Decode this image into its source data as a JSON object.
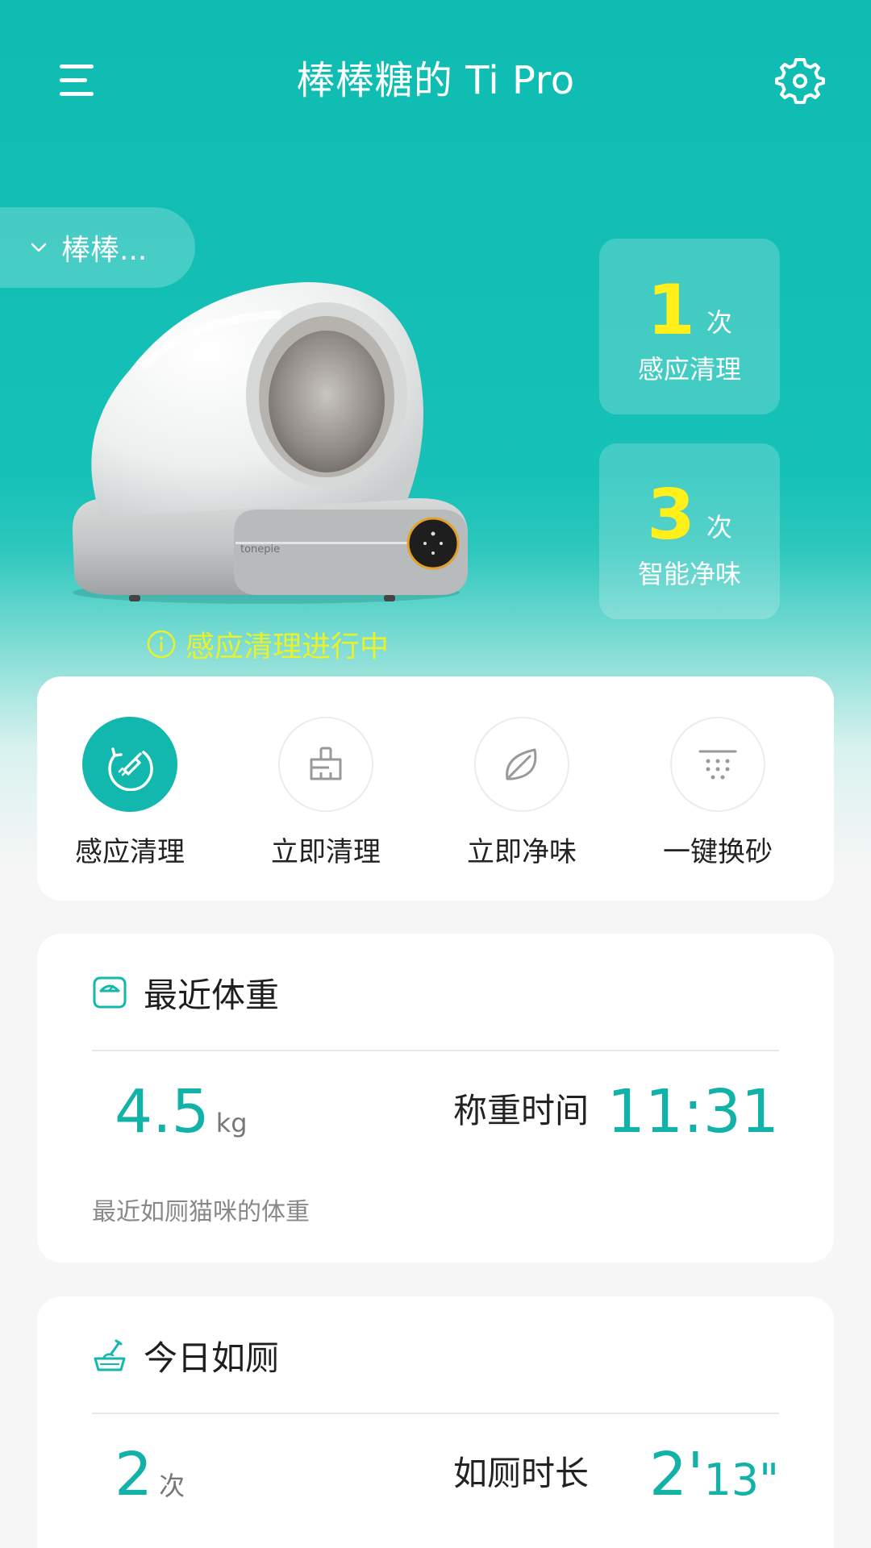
{
  "header": {
    "title": "棒棒糖的 Ti Pro",
    "menu_icon": "menu-icon",
    "settings_icon": "gear-icon"
  },
  "cat_selector": {
    "label": "棒棒..."
  },
  "device": {
    "brand_text": "tonepie"
  },
  "stats": [
    {
      "value": "1",
      "unit": "次",
      "label": "感应清理"
    },
    {
      "value": "3",
      "unit": "次",
      "label": "智能净味"
    }
  ],
  "status": {
    "text": "感应清理进行中",
    "color": "#e8f22a"
  },
  "actions": [
    {
      "label": "感应清理",
      "icon": "auto-clean-icon",
      "active": true
    },
    {
      "label": "立即清理",
      "icon": "broom-icon",
      "active": false
    },
    {
      "label": "立即净味",
      "icon": "leaf-icon",
      "active": false
    },
    {
      "label": "一键换砂",
      "icon": "litter-change-icon",
      "active": false
    }
  ],
  "weight_card": {
    "title": "最近体重",
    "value": "4.5",
    "unit": "kg",
    "time_label": "称重时间",
    "time_value": "11:31",
    "note": "最近如厕猫咪的体重"
  },
  "toilet_card": {
    "title": "今日如厕",
    "count": "2",
    "count_unit": "次",
    "duration_label": "如厕时长",
    "duration_min": "2'",
    "duration_sec": "13\""
  },
  "colors": {
    "accent": "#12b8ad",
    "highlight": "#ffef1a"
  }
}
